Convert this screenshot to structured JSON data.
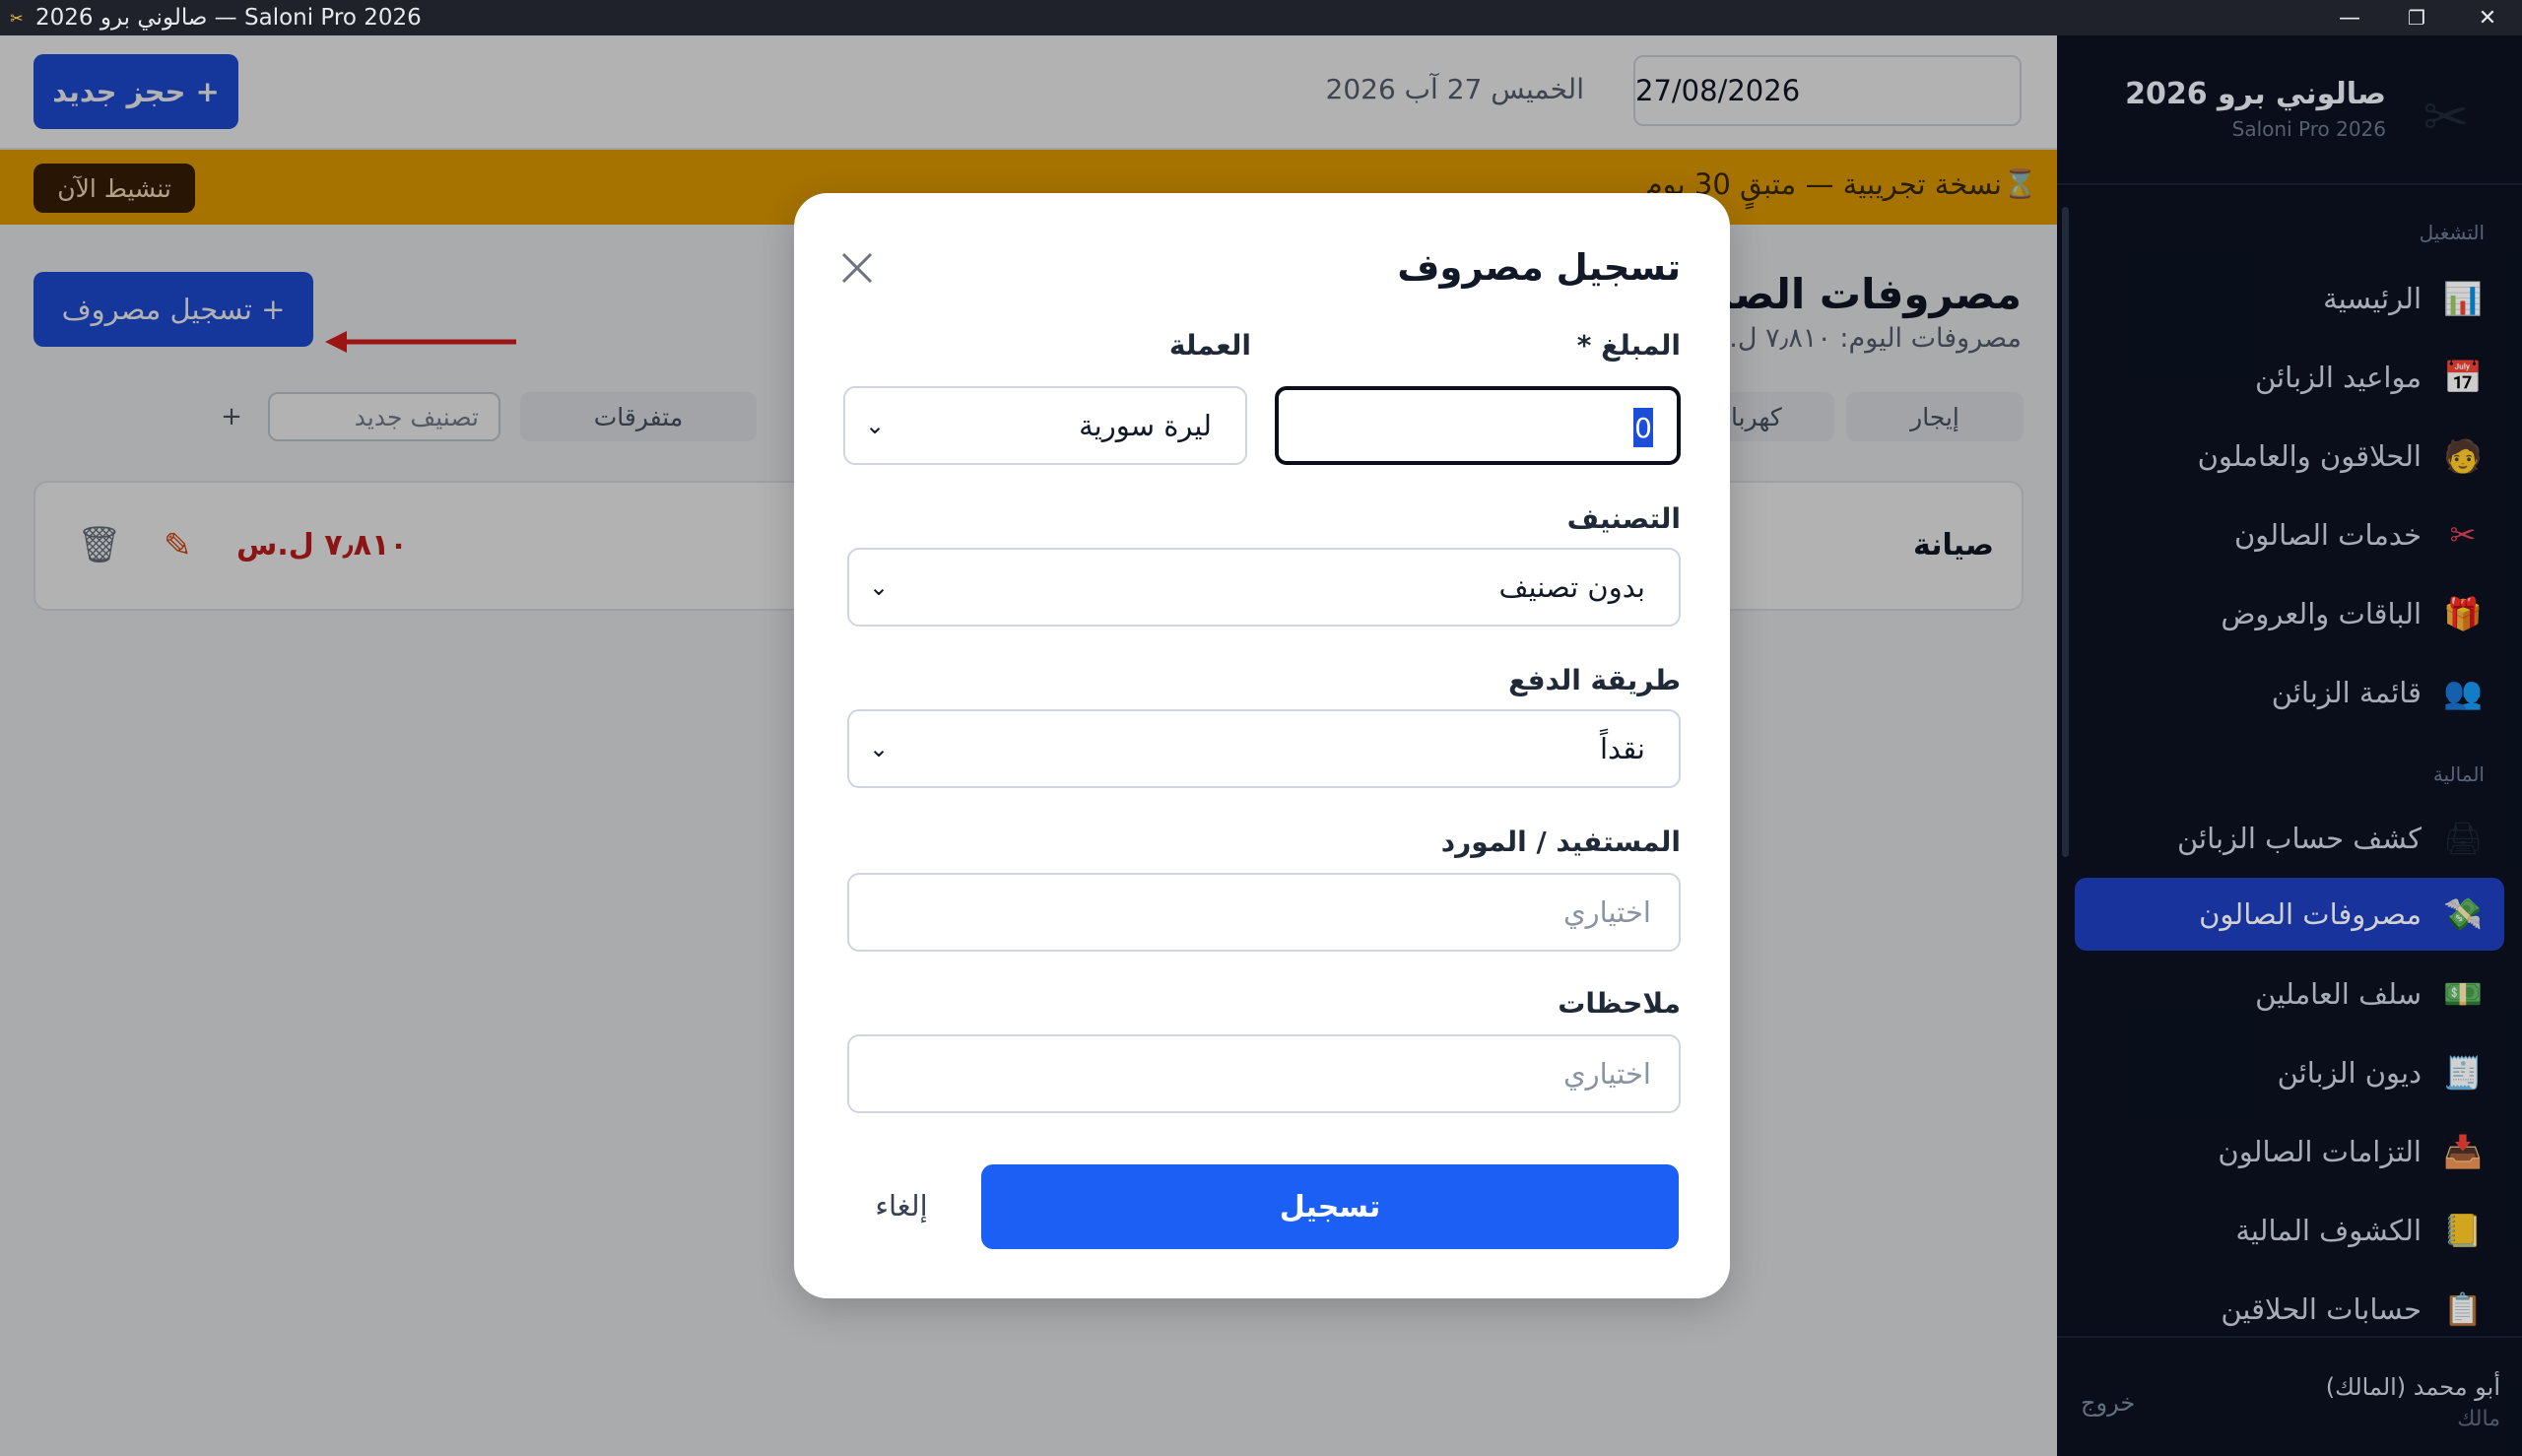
{
  "window": {
    "title": "صالوني برو 2026 — Saloni Pro 2026",
    "controls": {
      "minimize": "—",
      "maximize": "❐",
      "close": "✕"
    }
  },
  "sidebar": {
    "brand_title": "صالوني برو 2026",
    "brand_subtitle": "Saloni Pro 2026",
    "sections": {
      "operations": "التشغيل",
      "finance": "المالية"
    },
    "items": [
      {
        "label": "الرئيسية",
        "icon": "📊",
        "icon_name": "chart-icon"
      },
      {
        "label": "مواعيد الزبائن",
        "icon": "📅",
        "icon_name": "calendar-icon"
      },
      {
        "label": "الحلاقون والعاملون",
        "icon": "🧑",
        "icon_name": "worker-icon"
      },
      {
        "label": "خدمات الصالون",
        "icon": "✂",
        "icon_name": "scissors-icon"
      },
      {
        "label": "الباقات والعروض",
        "icon": "🎁",
        "icon_name": "gift-icon"
      },
      {
        "label": "قائمة الزبائن",
        "icon": "👥",
        "icon_name": "customers-icon"
      },
      {
        "label": "كشف حساب الزبائن",
        "icon": "🖨",
        "icon_name": "statement-icon"
      },
      {
        "label": "مصروفات الصالون",
        "icon": "💸",
        "icon_name": "expenses-icon",
        "active": true
      },
      {
        "label": "سلف العاملين",
        "icon": "💵",
        "icon_name": "cash-icon"
      },
      {
        "label": "ديون الزبائن",
        "icon": "🧾",
        "icon_name": "receipt-icon"
      },
      {
        "label": "التزامات الصالون",
        "icon": "📥",
        "icon_name": "inbox-icon"
      },
      {
        "label": "الكشوف المالية",
        "icon": "📒",
        "icon_name": "ledger-icon"
      },
      {
        "label": "حسابات الحلاقين",
        "icon": "📋",
        "icon_name": "clipboard-icon"
      }
    ],
    "user": {
      "name": "أبو محمد (المالك)",
      "role": "مالك",
      "logout": "خروج"
    }
  },
  "topbar": {
    "date_value": "27/08/2026",
    "date_label": "الخميس 27 آب 2026",
    "new_booking": "+ حجز جديد"
  },
  "trial": {
    "text": "نسخة تجريبية — متبقٍ 30 يوم",
    "icon": "⌛",
    "activate": "تنشيط الآن"
  },
  "page": {
    "title": "مصروفات الصالون",
    "subtitle": "مصروفات اليوم: ٧٫٨١٠ ل.س",
    "register_button": "+ تسجيل مصروف",
    "categories": [
      "إيجار",
      "كهرباء",
      "",
      "متفرقات"
    ],
    "new_category_placeholder": "تصنيف جديد",
    "add_symbol": "+",
    "expenses": [
      {
        "name": "صيانة",
        "amount": "٧٫٨١٠ ل.س"
      }
    ]
  },
  "modal": {
    "title": "تسجيل مصروف",
    "amount_label": "المبلغ *",
    "amount_value": "0",
    "currency_label": "العملة",
    "currency_value": "ليرة سورية",
    "category_label": "التصنيف",
    "category_value": "بدون تصنيف",
    "payment_label": "طريقة الدفع",
    "payment_value": "نقداً",
    "beneficiary_label": "المستفيد / المورد",
    "beneficiary_placeholder": "اختياري",
    "notes_label": "ملاحظات",
    "notes_placeholder": "اختياري",
    "submit": "تسجيل",
    "cancel": "إلغاء"
  },
  "colors": {
    "primary": "#1f50e0",
    "sidebar_bg": "#0b1220",
    "trial_bg": "#f0a500",
    "expense_amount": "#c81e1e",
    "annotation_arrow": "#e11d1d"
  }
}
